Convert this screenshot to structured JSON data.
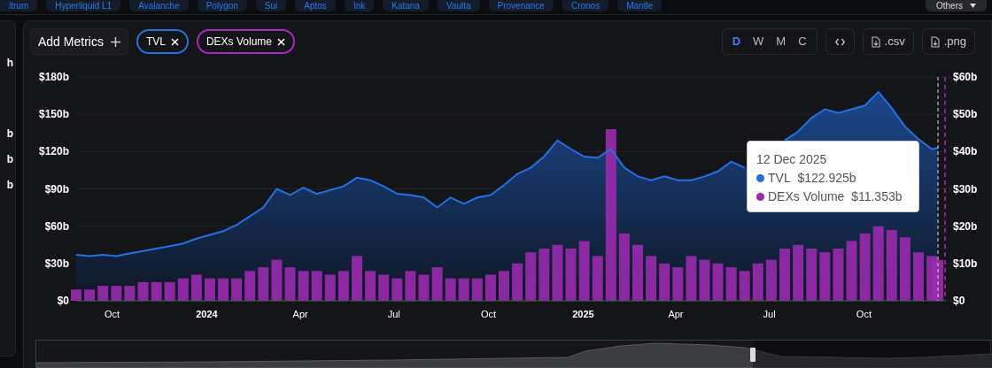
{
  "chain_pills": [
    {
      "label": "itrum"
    },
    {
      "label": "Hyperliquid L1"
    },
    {
      "label": "Avalanche"
    },
    {
      "label": "Polygon"
    },
    {
      "label": "Sui"
    },
    {
      "label": "Aptos"
    },
    {
      "label": "Ink"
    },
    {
      "label": "Katana"
    },
    {
      "label": "Vaulta"
    },
    {
      "label": "Provenance"
    },
    {
      "label": "Cronos"
    },
    {
      "label": "Mantle"
    }
  ],
  "others_dropdown": {
    "label": "Others"
  },
  "sidebar": {
    "items": [
      "h",
      "b",
      "b",
      "b"
    ]
  },
  "toolbar": {
    "add_metrics": "Add Metrics",
    "metrics": [
      {
        "label": "TVL",
        "color": "#2172e5"
      },
      {
        "label": "DEXs Volume",
        "color": "#b023c2"
      }
    ],
    "periods": [
      {
        "label": "D",
        "selected": true
      },
      {
        "label": "W",
        "selected": false
      },
      {
        "label": "M",
        "selected": false
      },
      {
        "label": "C",
        "selected": false
      }
    ],
    "exports": [
      ".csv",
      ".png"
    ]
  },
  "chart": {
    "chart_data": {
      "type": "area",
      "grid": true,
      "ref_lines": [
        {
          "axis": "x",
          "value": "2025-12-12",
          "color": "#dddddd"
        }
      ],
      "ylim": [
        0,
        180
      ],
      "y2lim": [
        0,
        60
      ],
      "xlim": [
        "2023-08-27",
        "2025-12-18"
      ],
      "yticks": [
        {
          "value": 0,
          "label": "$0"
        },
        {
          "value": 30,
          "label": "$30b"
        },
        {
          "value": 60,
          "label": "$60b"
        },
        {
          "value": 90,
          "label": "$90b"
        },
        {
          "value": 120,
          "label": "$120b"
        },
        {
          "value": 150,
          "label": "$150b"
        },
        {
          "value": 180,
          "label": "$180b"
        }
      ],
      "y2ticks": [
        {
          "value": 0,
          "label": "$0"
        },
        {
          "value": 10,
          "label": "$10b"
        },
        {
          "value": 20,
          "label": "$20b"
        },
        {
          "value": 30,
          "label": "$30b"
        },
        {
          "value": 40,
          "label": "$40b"
        },
        {
          "value": 50,
          "label": "$50b"
        },
        {
          "value": 60,
          "label": "$60b"
        }
      ],
      "xticks": [
        {
          "value": "2023-10-01",
          "label": "Oct"
        },
        {
          "value": "2024-01-01",
          "label": "2024"
        },
        {
          "value": "2024-04-01",
          "label": "Apr"
        },
        {
          "value": "2024-07-01",
          "label": "Jul"
        },
        {
          "value": "2024-10-01",
          "label": "Oct"
        },
        {
          "value": "2025-01-01",
          "label": "2025"
        },
        {
          "value": "2025-04-01",
          "label": "Apr"
        },
        {
          "value": "2025-07-01",
          "label": "Jul"
        },
        {
          "value": "2025-10-01",
          "label": "Oct"
        }
      ],
      "x": [
        "2023-08-27",
        "2023-09-09",
        "2023-09-22",
        "2023-10-05",
        "2023-10-18",
        "2023-10-31",
        "2023-11-13",
        "2023-11-26",
        "2023-12-09",
        "2023-12-22",
        "2024-01-04",
        "2024-01-17",
        "2024-01-30",
        "2024-02-12",
        "2024-02-25",
        "2024-03-09",
        "2024-03-22",
        "2024-04-04",
        "2024-04-17",
        "2024-04-30",
        "2024-05-13",
        "2024-05-26",
        "2024-06-08",
        "2024-06-21",
        "2024-07-04",
        "2024-07-17",
        "2024-07-30",
        "2024-08-12",
        "2024-08-25",
        "2024-09-07",
        "2024-09-20",
        "2024-10-03",
        "2024-10-16",
        "2024-10-29",
        "2024-11-11",
        "2024-11-24",
        "2024-12-07",
        "2024-12-20",
        "2025-01-02",
        "2025-01-15",
        "2025-01-28",
        "2025-02-10",
        "2025-02-23",
        "2025-03-08",
        "2025-03-21",
        "2025-04-03",
        "2025-04-16",
        "2025-04-29",
        "2025-05-12",
        "2025-05-25",
        "2025-06-07",
        "2025-06-20",
        "2025-07-03",
        "2025-07-16",
        "2025-07-29",
        "2025-08-11",
        "2025-08-24",
        "2025-09-06",
        "2025-09-19",
        "2025-10-02",
        "2025-10-15",
        "2025-10-28",
        "2025-11-10",
        "2025-11-23",
        "2025-12-06",
        "2025-12-12"
      ],
      "series": [
        {
          "name": "TVL",
          "color": "#2172e5",
          "values": [
            37,
            36,
            37,
            36,
            38,
            40,
            42,
            44,
            46,
            50,
            53,
            56,
            61,
            68,
            75,
            90,
            85,
            91,
            86,
            89,
            92,
            99,
            97,
            92,
            86,
            85,
            83,
            75,
            83,
            78,
            83,
            85,
            93,
            102,
            107,
            116,
            129,
            122,
            116,
            115,
            122,
            107,
            100,
            97,
            100,
            97,
            97,
            100,
            104,
            112,
            107,
            null,
            null,
            129,
            136,
            147,
            154,
            151,
            154,
            157,
            168,
            155,
            140,
            130,
            122,
            123
          ]
        },
        {
          "name": "DEXs Volume",
          "type": "bar",
          "axis": "y2",
          "color": "#9a2aae",
          "values": [
            3,
            3,
            4,
            4,
            4,
            5,
            5,
            5,
            6,
            7,
            6,
            6,
            6,
            8,
            9,
            11,
            9,
            8,
            8,
            7,
            8,
            12,
            8,
            7,
            6,
            8,
            7,
            9,
            6,
            6,
            6,
            7,
            8,
            10,
            13,
            14,
            15,
            14,
            16,
            12,
            46,
            18,
            15,
            12,
            10,
            9,
            12,
            11,
            10,
            9,
            8,
            10,
            11,
            14,
            15,
            14,
            13,
            14,
            16,
            18,
            20,
            19,
            17,
            13,
            12,
            11
          ]
        }
      ]
    },
    "tooltip": {
      "date": "12 Dec 2025",
      "rows": [
        {
          "value": "$122.925b",
          "color": "#1f6fe0"
        },
        {
          "value": "$11.353b",
          "color": "#9c27b0"
        }
      ]
    }
  }
}
